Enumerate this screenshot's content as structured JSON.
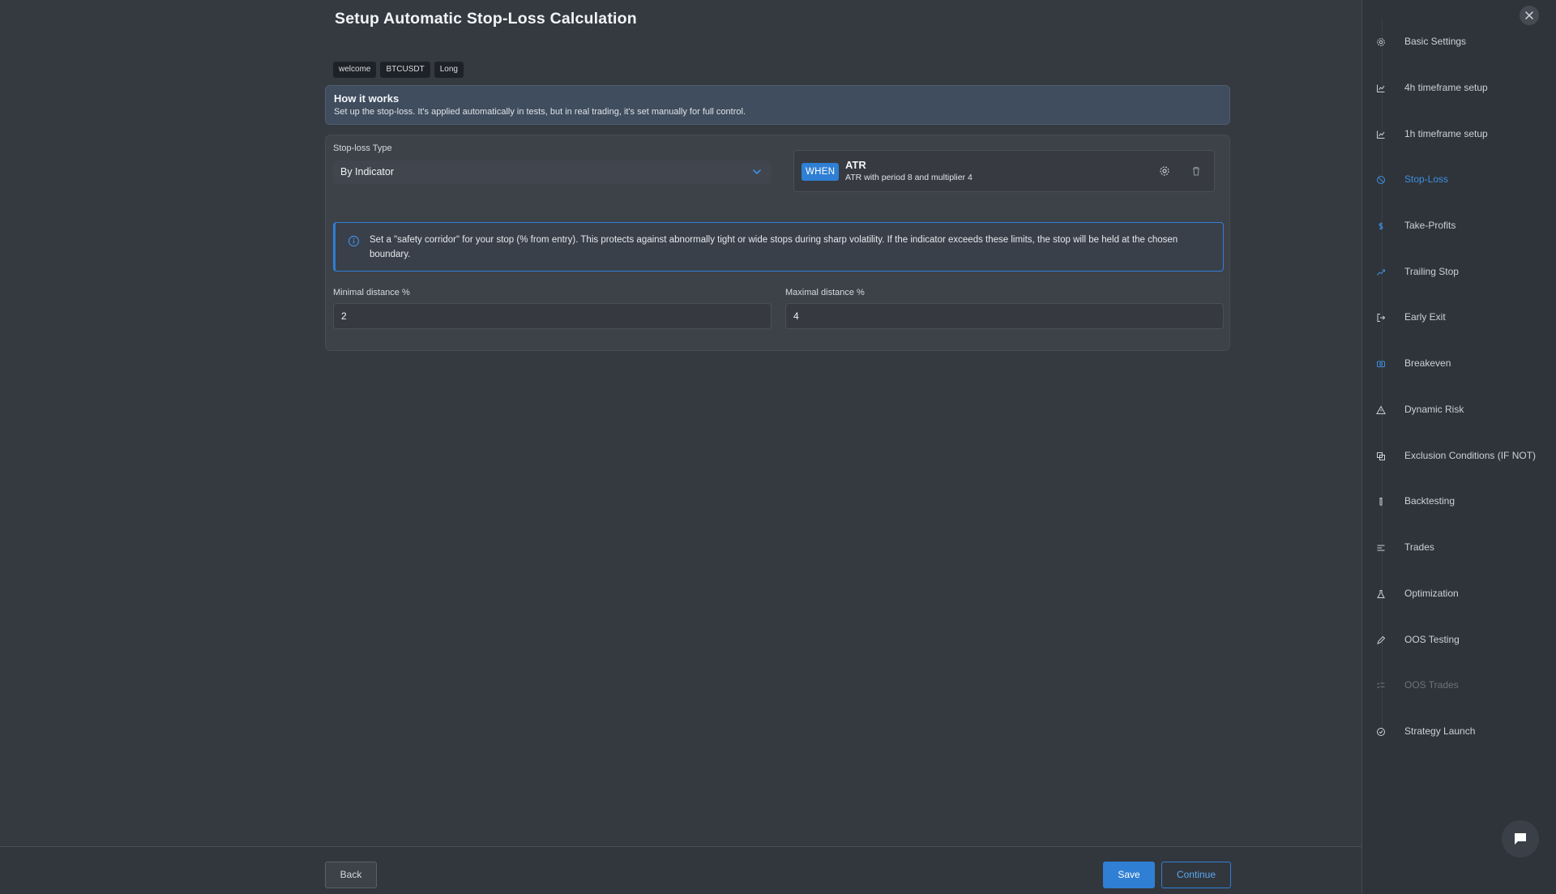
{
  "page": {
    "title": "Setup Automatic Stop-Loss Calculation",
    "tags": [
      "welcome",
      "BTCUSDT",
      "Long"
    ]
  },
  "how_it_works": {
    "title": "How it works",
    "text": "Set up the stop-loss. It's applied automatically in tests, but in real trading, it's set manually for full control."
  },
  "stop_loss": {
    "type_label": "Stop-loss Type",
    "type_value": "By Indicator",
    "condition_badge": "WHEN",
    "indicator_name": "ATR",
    "indicator_desc": "ATR with period 8 and multiplier 4",
    "info_text": "Set a \"safety corridor\" for your stop (% from entry). This protects against abnormally tight or wide stops during sharp volatility. If the indicator exceeds these limits, the stop will be held at the chosen boundary.",
    "min_label": "Minimal distance %",
    "min_value": "2",
    "max_label": "Maximal distance %",
    "max_value": "4"
  },
  "footer": {
    "back": "Back",
    "save": "Save",
    "continue": "Continue"
  },
  "sidebar": {
    "items": [
      {
        "label": "Basic Settings",
        "icon": "gear-icon"
      },
      {
        "label": "4h timeframe setup",
        "icon": "chart-icon"
      },
      {
        "label": "1h timeframe setup",
        "icon": "chart-icon"
      },
      {
        "label": "Stop-Loss",
        "icon": "stop-icon",
        "state": "active"
      },
      {
        "label": "Take-Profits",
        "icon": "dollar-icon"
      },
      {
        "label": "Trailing Stop",
        "icon": "trend-icon"
      },
      {
        "label": "Early Exit",
        "icon": "exit-icon"
      },
      {
        "label": "Breakeven",
        "icon": "scale-icon"
      },
      {
        "label": "Dynamic Risk",
        "icon": "warning-icon"
      },
      {
        "label": "Exclusion Conditions (IF NOT)",
        "icon": "copy-icon"
      },
      {
        "label": "Backtesting",
        "icon": "flask-icon"
      },
      {
        "label": "Trades",
        "icon": "list-icon"
      },
      {
        "label": "Optimization",
        "icon": "beaker-icon"
      },
      {
        "label": "OOS Testing",
        "icon": "pen-icon"
      },
      {
        "label": "OOS Trades",
        "icon": "checklist-icon",
        "state": "dim"
      },
      {
        "label": "Strategy Launch",
        "icon": "check-circle-icon"
      }
    ]
  },
  "colors": {
    "accent": "#2f7fd4",
    "background": "#353a41",
    "sidebar": "#2f343a"
  }
}
